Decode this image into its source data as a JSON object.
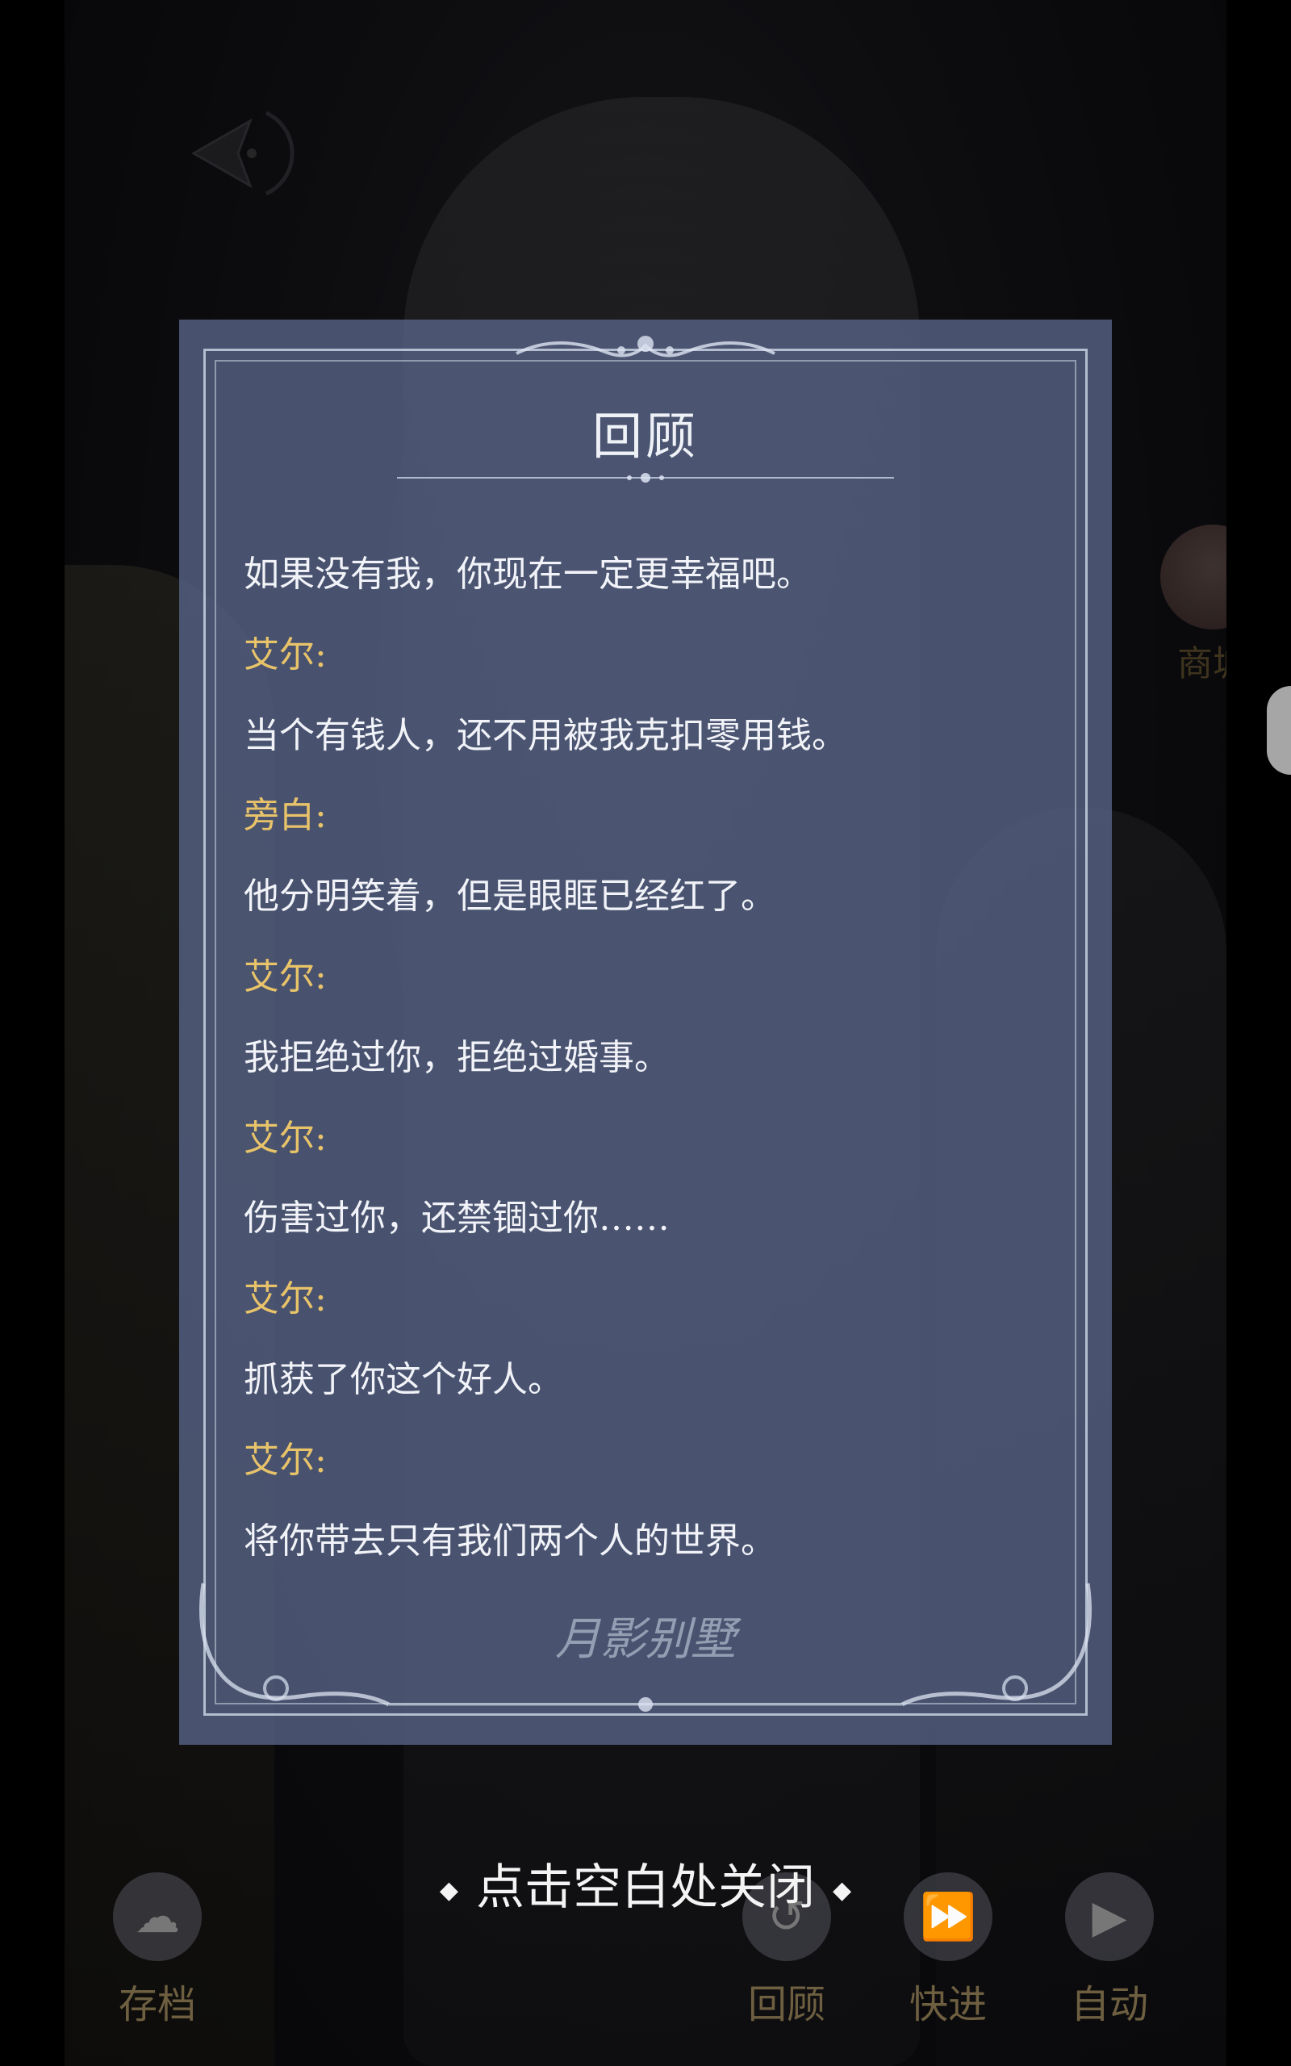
{
  "panel": {
    "title": "回顾",
    "logo": "月影别墅"
  },
  "log": [
    {
      "type": "line",
      "text": "如果没有我，你现在一定更幸福吧。"
    },
    {
      "type": "speaker",
      "text": "艾尔:"
    },
    {
      "type": "line",
      "text": "当个有钱人，还不用被我克扣零用钱。"
    },
    {
      "type": "speaker",
      "text": "旁白:"
    },
    {
      "type": "line",
      "text": "他分明笑着，但是眼眶已经红了。"
    },
    {
      "type": "speaker",
      "text": "艾尔:"
    },
    {
      "type": "line",
      "text": "我拒绝过你，拒绝过婚事。"
    },
    {
      "type": "speaker",
      "text": "艾尔:"
    },
    {
      "type": "line",
      "text": "伤害过你，还禁锢过你……"
    },
    {
      "type": "speaker",
      "text": "艾尔:"
    },
    {
      "type": "line",
      "text": "抓获了你这个好人。"
    },
    {
      "type": "speaker",
      "text": "艾尔:"
    },
    {
      "type": "line",
      "text": "将你带去只有我们两个人的世界。"
    }
  ],
  "close_hint": "点击空白处关闭",
  "background": {
    "shop_label": "商城",
    "bottom_bar": [
      {
        "label": "存档",
        "icon": "save-cloud-icon"
      },
      {
        "label": "回顾",
        "icon": "review-icon"
      },
      {
        "label": "快进",
        "icon": "fast-forward-icon"
      },
      {
        "label": "自动",
        "icon": "auto-play-icon"
      }
    ]
  },
  "colors": {
    "speaker": "#e8c36a",
    "dialogue": "#f1f3f8",
    "panel_bg": "#566284"
  }
}
